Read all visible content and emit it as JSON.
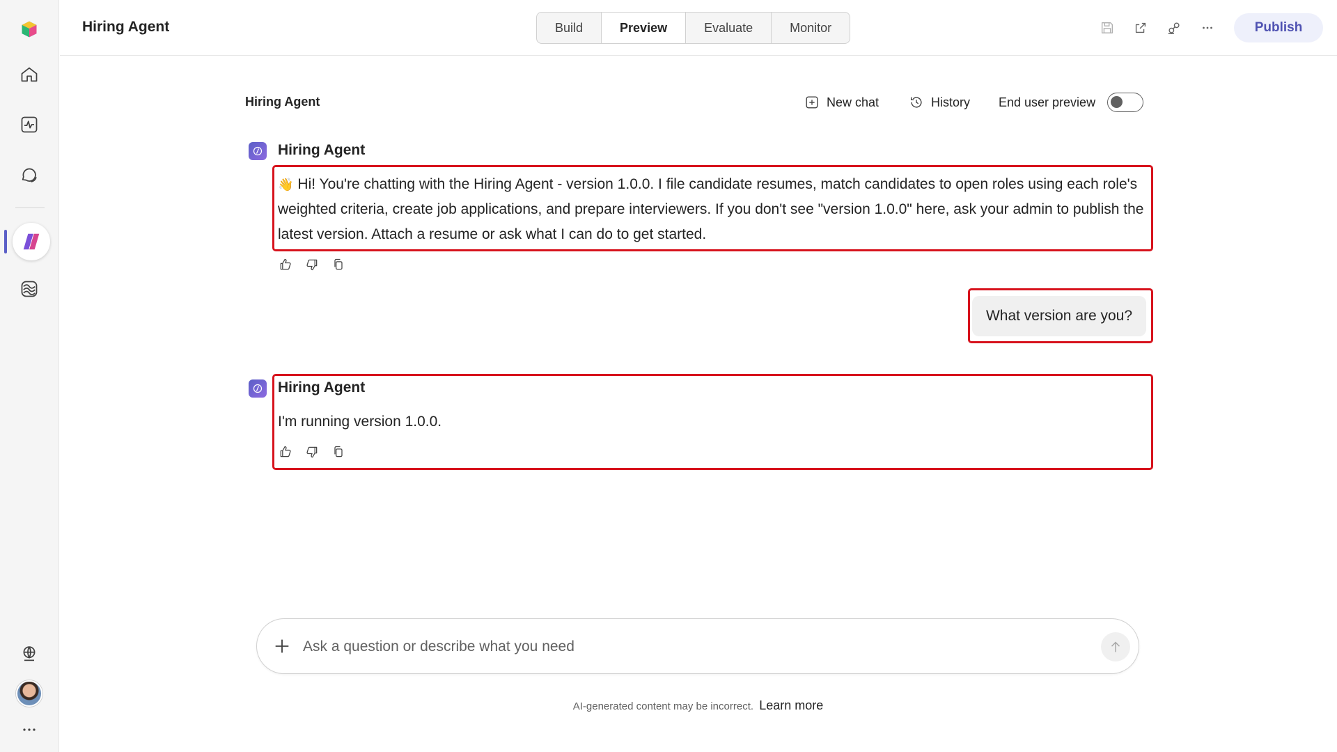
{
  "header": {
    "title": "Hiring Agent",
    "tabs": [
      {
        "label": "Build"
      },
      {
        "label": "Preview",
        "active": true
      },
      {
        "label": "Evaluate"
      },
      {
        "label": "Monitor"
      }
    ],
    "publish_label": "Publish"
  },
  "chat": {
    "name": "Hiring Agent",
    "new_chat_label": "New chat",
    "history_label": "History",
    "end_user_preview_label": "End user preview",
    "end_user_preview_on": false
  },
  "messages": [
    {
      "sender": "Hiring Agent",
      "emoji": "👋",
      "text": "Hi! You're chatting with the Hiring Agent - version 1.0.0. I file candidate resumes, match candidates to open roles using each role's weighted criteria, create job applications, and prepare interviewers. If you don't see \"version 1.0.0\" here, ask your admin to publish the latest version. Attach a resume or ask what I can do to get started."
    },
    {
      "sender": "user",
      "text": "What version are you?"
    },
    {
      "sender": "Hiring Agent",
      "text": "I'm running version 1.0.0."
    }
  ],
  "composer": {
    "placeholder": "Ask a question or describe what you need"
  },
  "footer": {
    "disclaimer": "AI-generated content may be incorrect.",
    "learn_more": "Learn more"
  },
  "colors": {
    "accent": "#5b5fc7",
    "highlight_border": "#d7131d",
    "publish_text": "#4f52b2",
    "publish_bg": "#eef0fb"
  }
}
